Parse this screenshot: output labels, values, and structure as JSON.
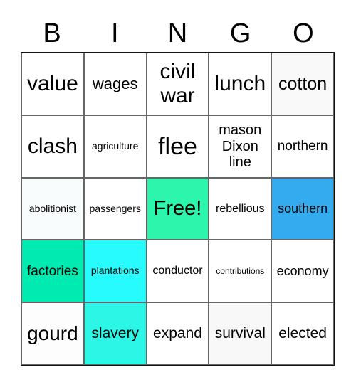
{
  "header": [
    "B",
    "I",
    "N",
    "G",
    "O"
  ],
  "cells": [
    {
      "text": "value",
      "size": 30,
      "bg": "#ffffff"
    },
    {
      "text": "wages",
      "size": 22,
      "bg": "#ffffff"
    },
    {
      "text": "civil war",
      "size": 30,
      "bg": "#ffffff"
    },
    {
      "text": "lunch",
      "size": 30,
      "bg": "#ffffff"
    },
    {
      "text": "cotton",
      "size": 25,
      "bg": "#f9f9f9"
    },
    {
      "text": "clash",
      "size": 30,
      "bg": "#ffffff"
    },
    {
      "text": "agriculture",
      "size": 14,
      "bg": "#ffffff"
    },
    {
      "text": "flee",
      "size": 34,
      "bg": "#ffffff"
    },
    {
      "text": "mason Dixon line",
      "size": 20,
      "bg": "#ffffff"
    },
    {
      "text": "northern",
      "size": 19,
      "bg": "#ffffff"
    },
    {
      "text": "abolitionist",
      "size": 14,
      "bg": "#f9fcfc"
    },
    {
      "text": "passengers",
      "size": 14,
      "bg": "#ffffff"
    },
    {
      "text": "Free!",
      "size": 29,
      "bg": "#2cf5ac"
    },
    {
      "text": "rebellious",
      "size": 16,
      "bg": "#ffffff"
    },
    {
      "text": "southern",
      "size": 18,
      "bg": "#33abee"
    },
    {
      "text": "factories",
      "size": 19,
      "bg": "#00ebb1"
    },
    {
      "text": "plantations",
      "size": 14,
      "bg": "#28fbfd"
    },
    {
      "text": "conductor",
      "size": 16,
      "bg": "#ffffff"
    },
    {
      "text": "contributions",
      "size": 12,
      "bg": "#ffffff"
    },
    {
      "text": "economy",
      "size": 18,
      "bg": "#ffffff"
    },
    {
      "text": "gourd",
      "size": 28,
      "bg": "#fdfdfd"
    },
    {
      "text": "slavery",
      "size": 21,
      "bg": "#2cf7e7"
    },
    {
      "text": "expand",
      "size": 21,
      "bg": "#ffffff"
    },
    {
      "text": "survival",
      "size": 21,
      "bg": "#f8f8f8"
    },
    {
      "text": "elected",
      "size": 21,
      "bg": "#ffffff"
    }
  ]
}
